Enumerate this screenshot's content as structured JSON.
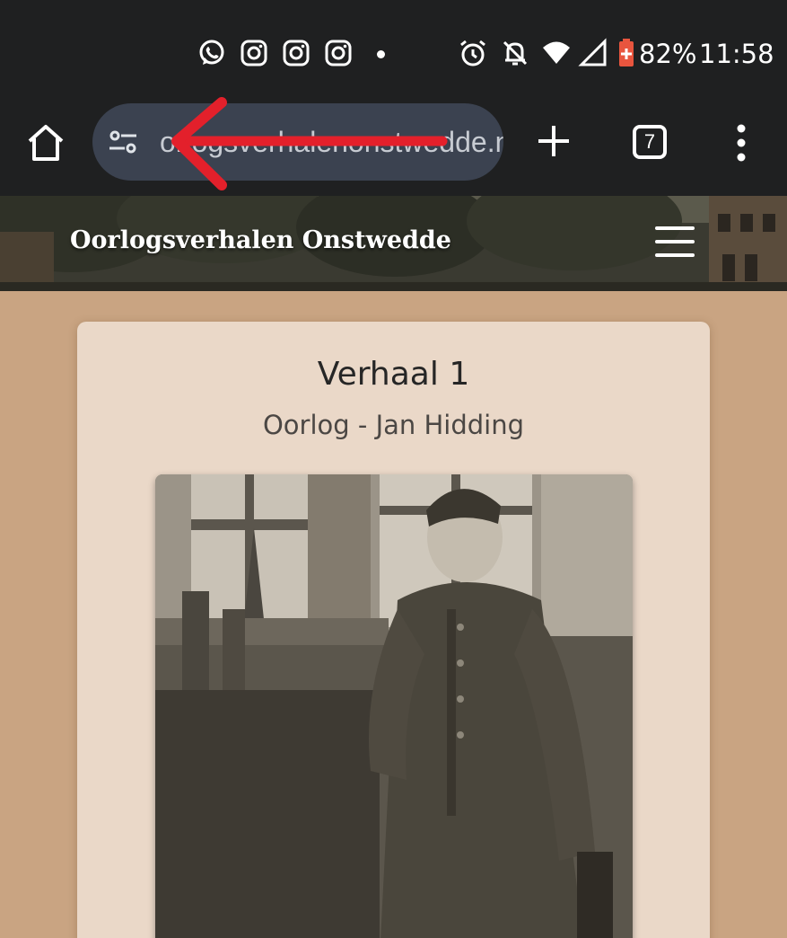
{
  "status_bar": {
    "notification_icons": [
      "whatsapp-icon",
      "instagram-icon",
      "instagram-icon",
      "instagram-icon"
    ],
    "more_dot": "•",
    "system_icons": [
      "alarm-icon",
      "notifications-off-icon",
      "wifi-icon",
      "signal-icon",
      "battery-saver-icon"
    ],
    "battery": "82%",
    "time": "11:58"
  },
  "browser": {
    "url_display": "orlogsverhalenonstwedde.nl",
    "tab_count": "7",
    "icons": [
      "home-icon",
      "site-settings-icon",
      "new-tab-icon",
      "tab-switcher-icon",
      "menu-icon"
    ]
  },
  "site": {
    "title": "Oorlogsverhalen Onstwedde"
  },
  "story": {
    "title": "Verhaal 1",
    "subtitle": "Oorlog - Jan Hidding"
  },
  "colors": {
    "status_bar_bg": "#1f2021",
    "url_bar_bg": "#3b4250",
    "page_bg": "#c9a482",
    "card_bg": "#ead8c8",
    "annotation_arrow": "#e3202b"
  }
}
